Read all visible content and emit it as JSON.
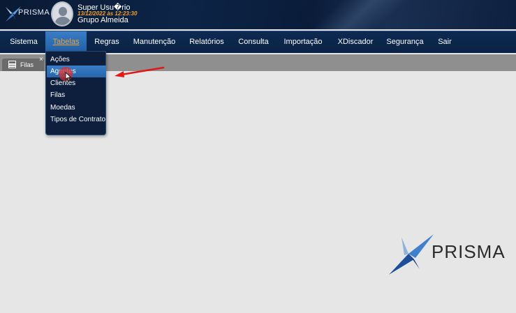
{
  "header": {
    "logo_text": "PRISMA",
    "user_name": "Super Usu�rio",
    "datetime": "13/12/2022 às 12:23:30",
    "company": "Grupo Almeida"
  },
  "menu": {
    "items": [
      {
        "label": "Sistema"
      },
      {
        "label": "Tabelas"
      },
      {
        "label": "Regras"
      },
      {
        "label": "Manutenção"
      },
      {
        "label": "Relatórios"
      },
      {
        "label": "Consulta"
      },
      {
        "label": "Importação"
      },
      {
        "label": "XDiscador"
      },
      {
        "label": "Segurança"
      },
      {
        "label": "Sair"
      }
    ],
    "active": "Tabelas"
  },
  "tab": {
    "label": "Filas",
    "close": "×"
  },
  "dropdown": {
    "items": [
      {
        "label": "Ações"
      },
      {
        "label": "Agentes"
      },
      {
        "label": "Clientes"
      },
      {
        "label": "Filas"
      },
      {
        "label": "Moedas"
      },
      {
        "label": "Tipos de Contrato"
      }
    ],
    "highlighted": "Agentes"
  },
  "watermark": {
    "logo_text": "PRISMA"
  },
  "colors": {
    "header_bg": "#0d2447",
    "menu_active": "#2a6bb4",
    "menu_active_text": "#f2a22f",
    "datetime_text": "#f2a22f",
    "workspace_bg": "#e6e6e6",
    "logo_blue": "#1f4f95"
  },
  "icons": {
    "tab_icon": "list-icon",
    "user_avatar": "user-avatar-icon",
    "logo_mark": "prisma-x-logo-icon",
    "annotation": "red-arrow-icon",
    "pointer": "mouse-cursor-icon"
  }
}
